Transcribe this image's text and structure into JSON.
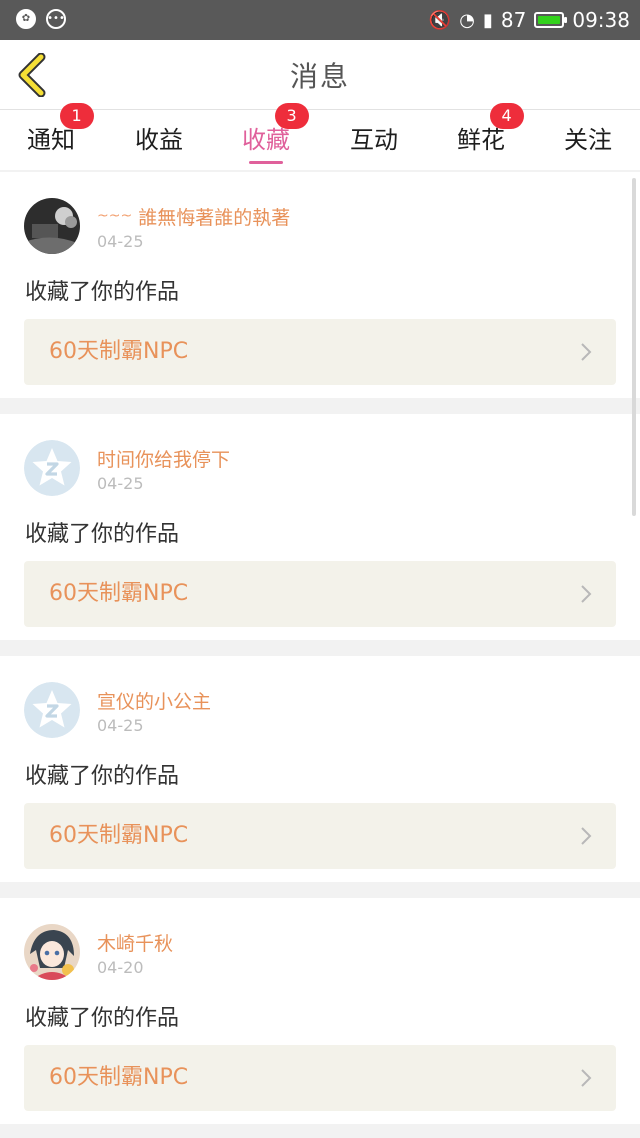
{
  "status_bar": {
    "battery": "87",
    "time": "09:38",
    "battery_color": "#33d11c"
  },
  "header": {
    "title": "消息"
  },
  "tabs": [
    {
      "label": "通知",
      "badge": "1"
    },
    {
      "label": "收益",
      "badge": ""
    },
    {
      "label": "收藏",
      "badge": "3",
      "active": true
    },
    {
      "label": "互动",
      "badge": ""
    },
    {
      "label": "鲜花",
      "badge": "4"
    },
    {
      "label": "关注",
      "badge": ""
    }
  ],
  "notifications": [
    {
      "user": "誰無悔著誰的執著",
      "user_deco": "~~~",
      "date": "04-25",
      "action": "收藏了你的作品",
      "work": "60天制霸NPC",
      "avatar": "photo-dark"
    },
    {
      "user": "时间你给我停下",
      "date": "04-25",
      "action": "收藏了你的作品",
      "work": "60天制霸NPC",
      "avatar": "default-star"
    },
    {
      "user": "宣仪的小公主",
      "date": "04-25",
      "action": "收藏了你的作品",
      "work": "60天制霸NPC",
      "avatar": "default-star"
    },
    {
      "user": "木崎千秋",
      "date": "04-20",
      "action": "收藏了你的作品",
      "work": "60天制霸NPC",
      "avatar": "anime-girl"
    }
  ],
  "colors": {
    "accent_pink": "#e0609b",
    "username_orange": "#e8925a",
    "badge_red": "#ee2d3b",
    "back_arrow_yellow": "#f5df35"
  }
}
